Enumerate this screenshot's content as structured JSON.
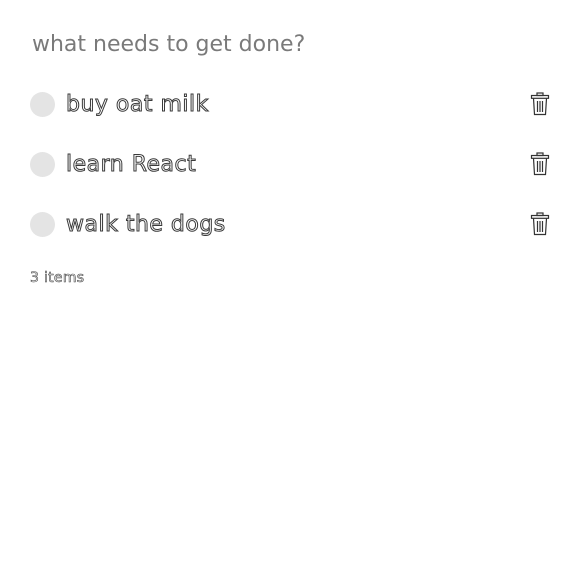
{
  "new_todo": {
    "placeholder": "what needs to get done?",
    "value": ""
  },
  "todos": [
    {
      "label": "buy oat milk",
      "completed": false,
      "toggle_icon": "circle-toggle-icon",
      "delete_icon": "trash-icon"
    },
    {
      "label": "learn React",
      "completed": false,
      "toggle_icon": "circle-toggle-icon",
      "delete_icon": "trash-icon"
    },
    {
      "label": "walk the dogs",
      "completed": false,
      "toggle_icon": "circle-toggle-icon",
      "delete_icon": "trash-icon"
    }
  ],
  "footer": {
    "count_text": "3 items"
  },
  "colors": {
    "background": "#ffffff",
    "toggle_fill": "#e4e4e4",
    "placeholder_text": "#7a7a7a",
    "outline_text": "#3a3a3a"
  }
}
